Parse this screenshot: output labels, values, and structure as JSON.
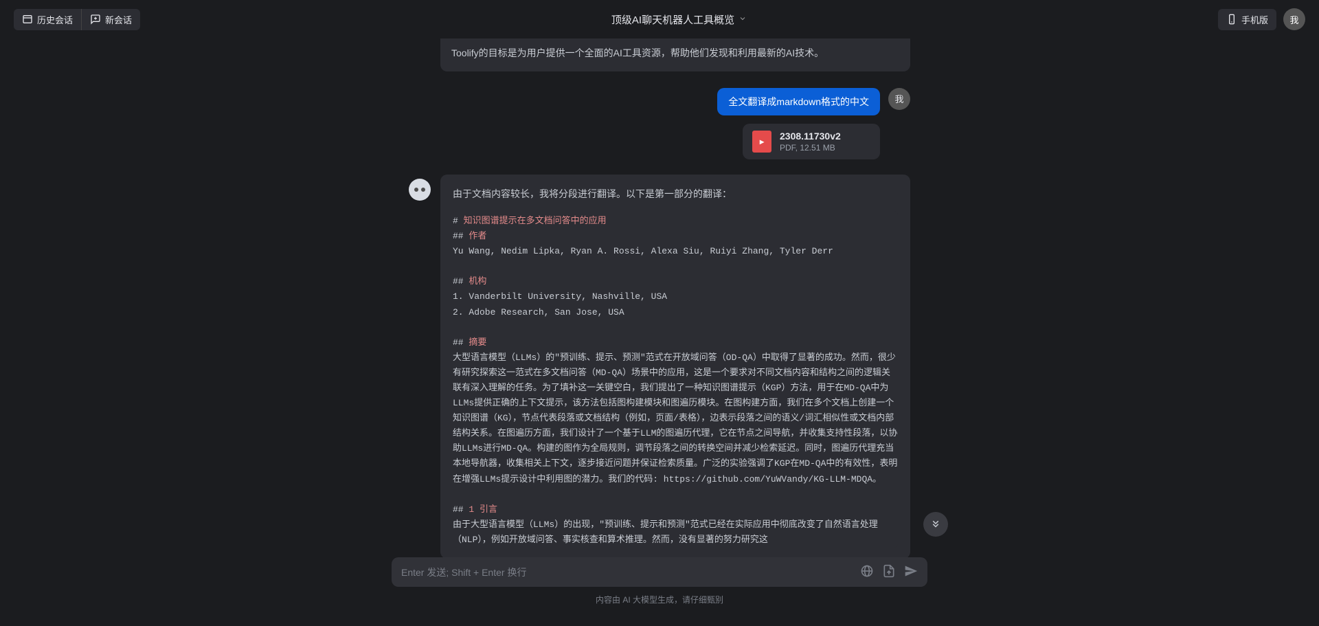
{
  "header": {
    "history_label": "历史会话",
    "new_label": "新会话",
    "title": "顶级AI聊天机器人工具概览",
    "mobile_label": "手机版",
    "avatar_text": "我"
  },
  "top_snippet": "Toolify的目标是为用户提供一个全面的AI工具资源，帮助他们发现和利用最新的AI技术。",
  "user_msg": "全文翻译成markdown格式的中文",
  "user_avatar": "我",
  "file": {
    "name": "2308.11730v2",
    "meta": "PDF, 12.51 MB"
  },
  "ai": {
    "intro": "由于文档内容较长，我将分段进行翻译。以下是第一部分的翻译：",
    "md": {
      "h1_prefix": "# ",
      "h1": "知识图谱提示在多文档问答中的应用",
      "h2a_prefix": "## ",
      "h2a": "作者",
      "authors": "Yu Wang, Nedim Lipka, Ryan A. Rossi, Alexa Siu, Ruiyi Zhang, Tyler Derr",
      "h2b_prefix": "## ",
      "h2b": "机构",
      "inst1": "1. Vanderbilt University, Nashville, USA",
      "inst2": "2. Adobe Research, San Jose, USA",
      "h2c_prefix": "## ",
      "h2c": "摘要",
      "abstract": "大型语言模型（LLMs）的\"预训练、提示、预测\"范式在开放域问答（OD-QA）中取得了显著的成功。然而，很少有研究探索这一范式在多文档问答（MD-QA）场景中的应用，这是一个要求对不同文档内容和结构之间的逻辑关联有深入理解的任务。为了填补这一关键空白，我们提出了一种知识图谱提示（KGP）方法，用于在MD-QA中为LLMs提供正确的上下文提示，该方法包括图构建模块和图遍历模块。在图构建方面，我们在多个文档上创建一个知识图谱（KG），节点代表段落或文档结构（例如，页面/表格），边表示段落之间的语义/词汇相似性或文档内部结构关系。在图遍历方面，我们设计了一个基于LLM的图遍历代理，它在节点之间导航，并收集支持性段落，以协助LLMs进行MD-QA。构建的图作为全局规则，调节段落之间的转换空间并减少检索延迟。同时，图遍历代理充当本地导航器，收集相关上下文，逐步接近问题并保证检索质量。广泛的实验强调了KGP在MD-QA中的有效性，表明在增强LLMs提示设计中利用图的潜力。我们的代码: https://github.com/YuWVandy/KG-LLM-MDQA。",
      "h2d_prefix": "## ",
      "h2d_num": "1",
      "h2d": " 引言",
      "intro_body": "由于大型语言模型（LLMs）的出现，\"预训练、提示和预测\"范式已经在实际应用中彻底改变了自然语言处理（NLP），例如开放域问答、事实核查和算术推理。然而，没有显著的努力研究这"
    }
  },
  "input": {
    "placeholder": "Enter 发送; Shift + Enter 换行"
  },
  "disclaimer": "内容由 AI 大模型生成，请仔细甄别"
}
